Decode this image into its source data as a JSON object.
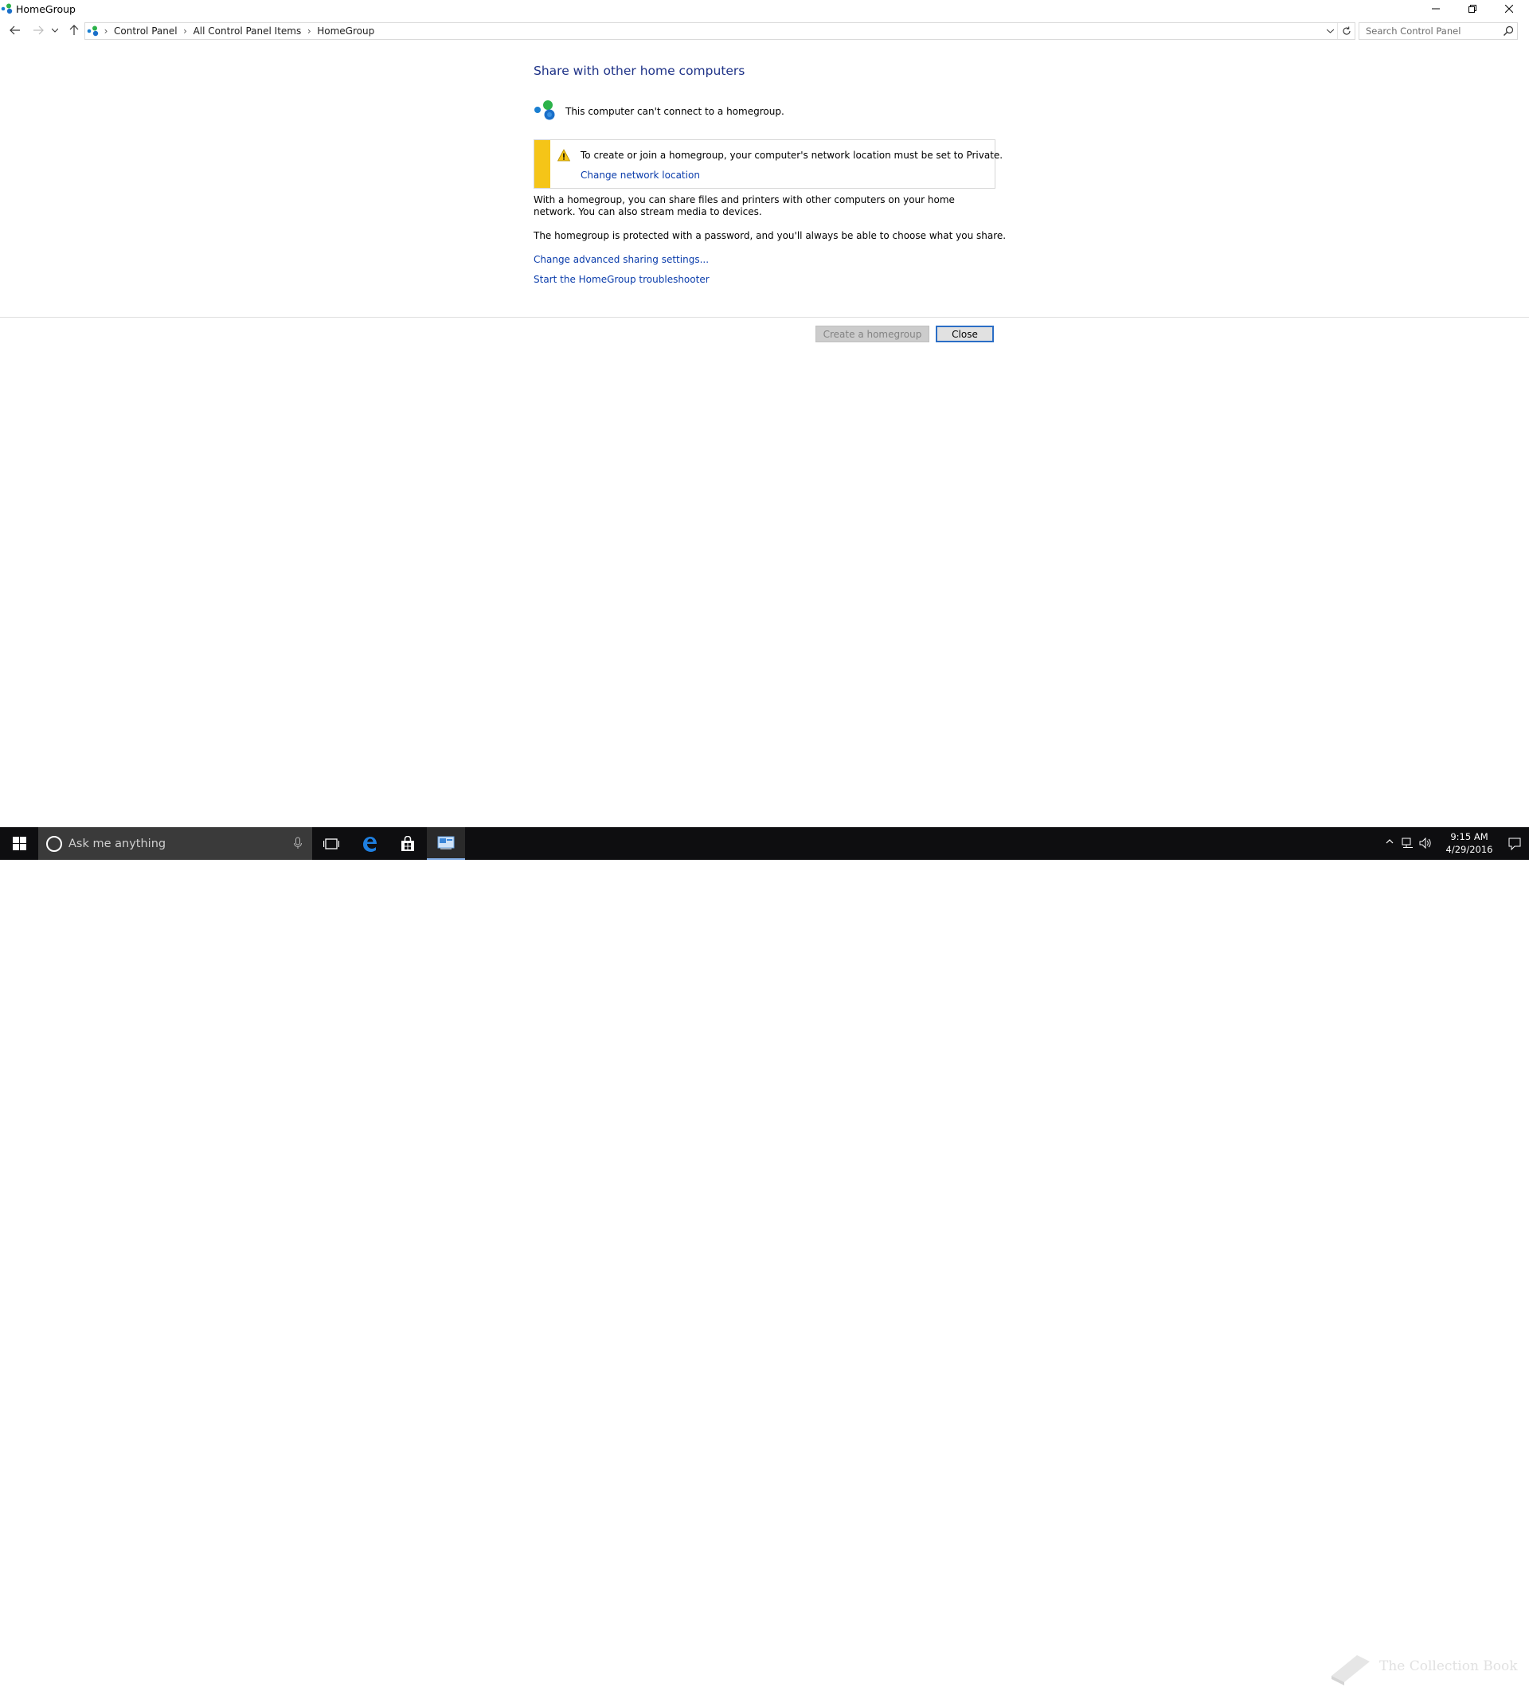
{
  "window": {
    "title": "HomeGroup",
    "icon": "homegroup-icon"
  },
  "address": {
    "crumbs": [
      "Control Panel",
      "All Control Panel Items",
      "HomeGroup"
    ],
    "search_placeholder": "Search Control Panel"
  },
  "content": {
    "heading": "Share with other home computers",
    "status": "This computer can't connect to a homegroup.",
    "warning": {
      "text": "To create or join a homegroup, your computer's network location must be set to Private.",
      "link": "Change network location",
      "stripe_color": "#f5c518"
    },
    "description": "With a homegroup, you can share files and printers with other computers on your home network. You can also stream media to devices.",
    "password_note": "The homegroup is protected with a password, and you'll always be able to choose what you share.",
    "links": {
      "advanced": "Change advanced sharing settings...",
      "troubleshooter": "Start the HomeGroup troubleshooter"
    }
  },
  "buttons": {
    "create": "Create a homegroup",
    "close": "Close"
  },
  "taskbar": {
    "search_placeholder": "Ask me anything",
    "time": "9:15 AM",
    "date": "4/29/2016",
    "watermark": "The Collection Book"
  },
  "colors": {
    "link": "#0a3cab",
    "heading": "#1e3287",
    "taskbar": "#0e0e10"
  }
}
